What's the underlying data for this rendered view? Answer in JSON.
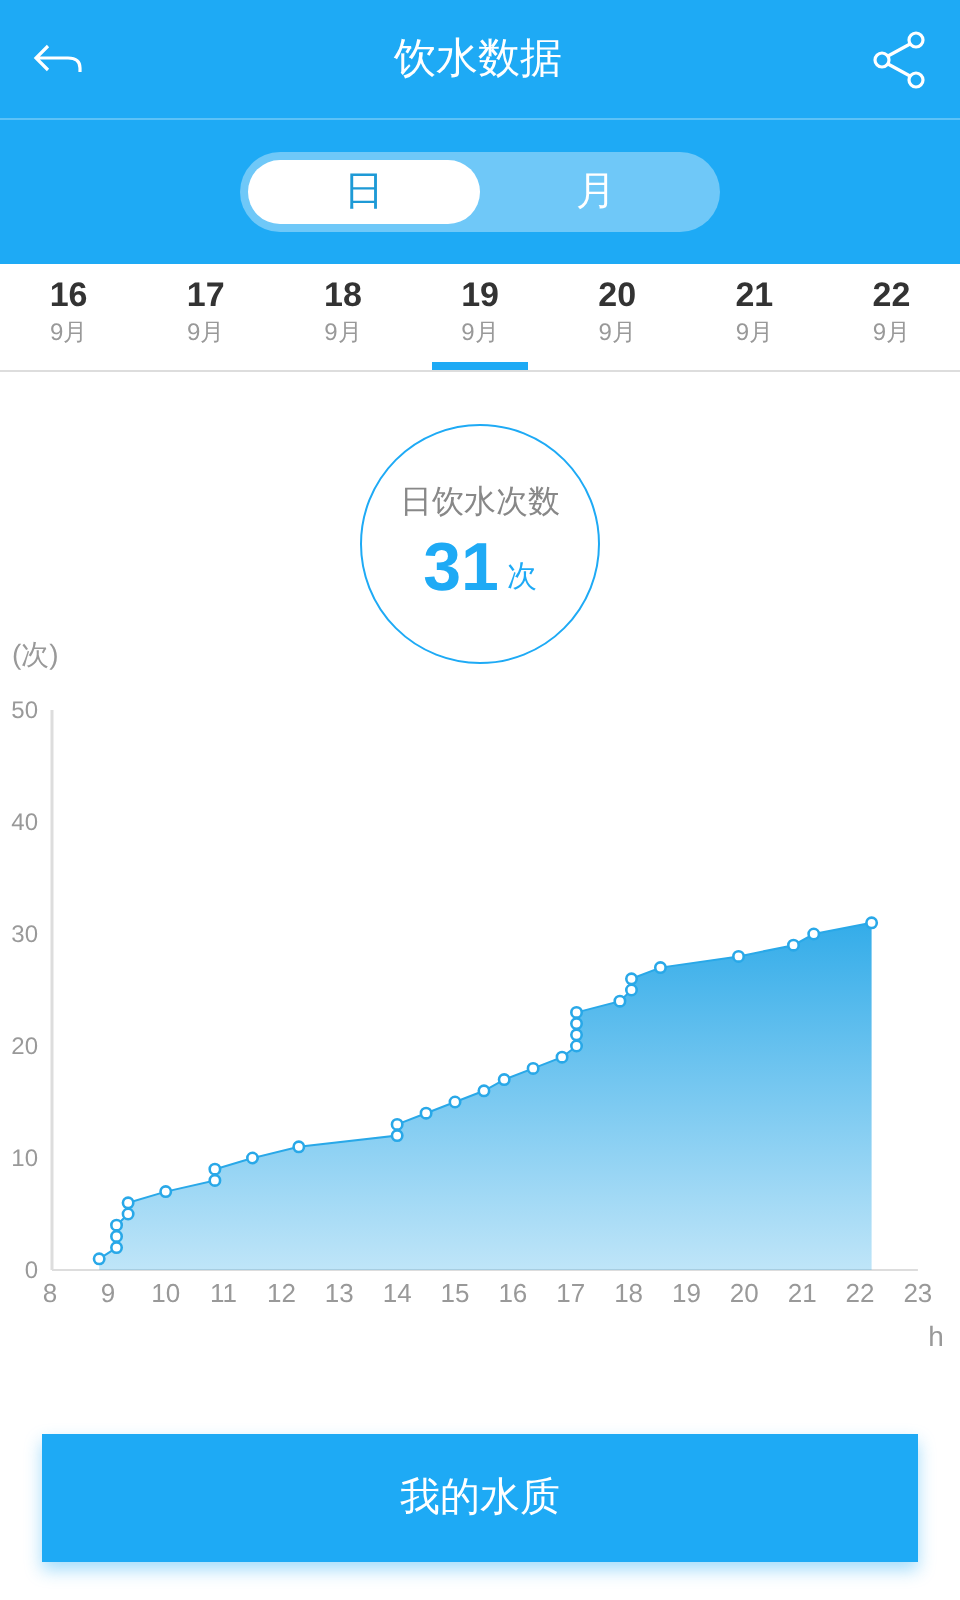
{
  "header": {
    "title": "饮水数据"
  },
  "tabs": [
    {
      "label": "日",
      "selected": true
    },
    {
      "label": "月",
      "selected": false
    }
  ],
  "dates": [
    {
      "day": "16",
      "month": "9月",
      "selected": false
    },
    {
      "day": "17",
      "month": "9月",
      "selected": false
    },
    {
      "day": "18",
      "month": "9月",
      "selected": false
    },
    {
      "day": "19",
      "month": "9月",
      "selected": true
    },
    {
      "day": "20",
      "month": "9月",
      "selected": false
    },
    {
      "day": "21",
      "month": "9月",
      "selected": false
    },
    {
      "day": "22",
      "month": "9月",
      "selected": false
    }
  ],
  "summary": {
    "label": "日饮水次数",
    "count": "31",
    "unit": "次"
  },
  "chart": {
    "chart_data": {
      "type": "area",
      "xlabel": "h",
      "ylabel": "(次)",
      "x": [
        8.85,
        9.15,
        9.15,
        9.15,
        9.35,
        9.35,
        10,
        10.85,
        10.85,
        11.5,
        12.3,
        14,
        14,
        14.5,
        15,
        15.5,
        15.85,
        16.35,
        16.85,
        17.1,
        17.1,
        17.1,
        17.1,
        17.85,
        18.05,
        18.05,
        18.55,
        19.9,
        20.85,
        21.2,
        22.2
      ],
      "series": [
        {
          "color": "#29a8e8",
          "values": [
            1,
            2,
            3,
            4,
            5,
            6,
            7,
            8,
            9,
            10,
            11,
            12,
            13,
            14,
            15,
            16,
            17,
            18,
            19,
            20,
            21,
            22,
            23,
            24,
            25,
            26,
            27,
            28,
            29,
            30,
            31
          ]
        }
      ],
      "xlim": [
        8,
        23
      ],
      "ylim": [
        0,
        50
      ],
      "xticks": [
        8,
        9,
        10,
        11,
        12,
        13,
        14,
        15,
        16,
        17,
        18,
        19,
        20,
        21,
        22,
        23
      ],
      "yticks": [
        0,
        10,
        20,
        30,
        40,
        50
      ]
    }
  },
  "button": {
    "label": "我的水质"
  }
}
